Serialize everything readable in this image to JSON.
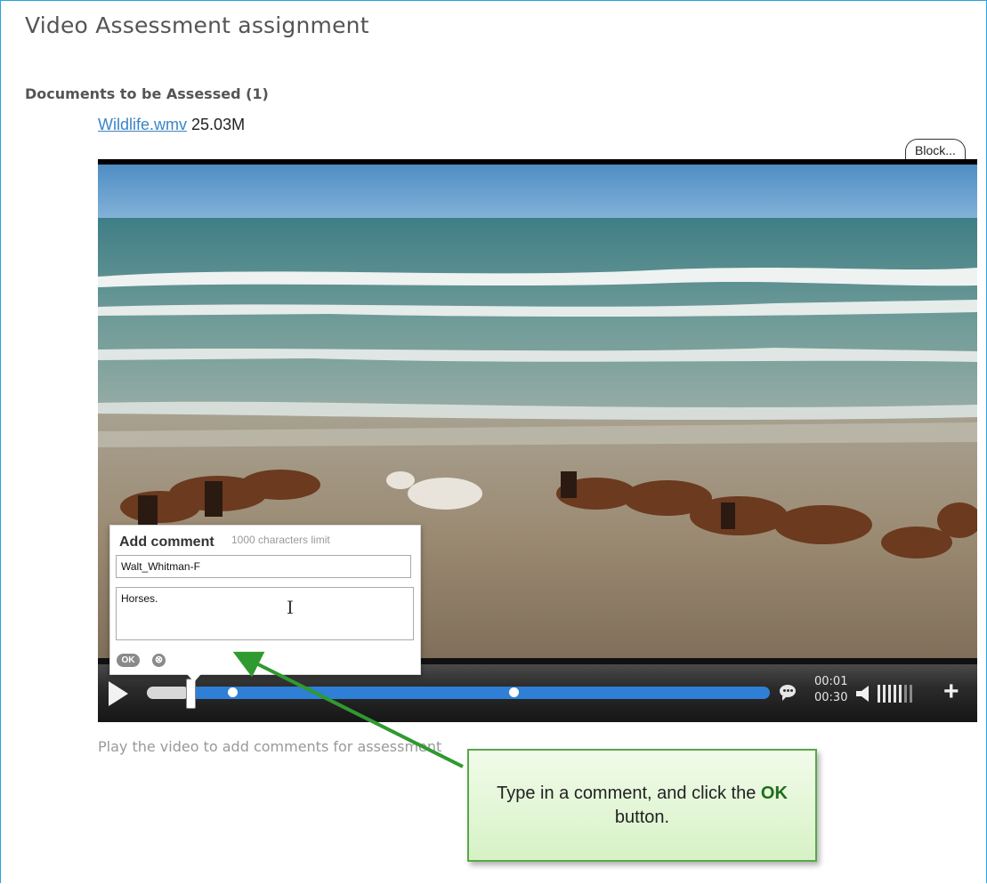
{
  "page": {
    "title": "Video Assessment assignment"
  },
  "documents": {
    "heading": "Documents to be Assessed (1)",
    "file_name": "Wildlife.wmv",
    "file_size": "25.03M"
  },
  "player": {
    "block_label": "Block...",
    "current_time": "00:01",
    "total_time": "00:30",
    "progress_fraction": 0.03,
    "comment_markers": [
      0.08,
      0.56
    ],
    "volume_level": 0.7,
    "colors": {
      "progress": "#2f7fd6",
      "controls": "#2b2b2b"
    },
    "icons": [
      "play-icon",
      "comment-bubble-icon",
      "volume-icon",
      "plus-icon"
    ]
  },
  "comment_popup": {
    "title": "Add comment",
    "limit_text": "1000 characters limit",
    "name_value": "Walt_Whitman-F",
    "comment_value": "Horses.",
    "ok_label": "OK",
    "close_label": "⊗"
  },
  "hint": "Play the video to add comments for assessment",
  "callout": {
    "text_before": "Type in a comment, and click the ",
    "bold": "OK",
    "text_after": " button.",
    "colors": {
      "border": "#58a84a",
      "arrow": "#2f9a2f"
    }
  }
}
